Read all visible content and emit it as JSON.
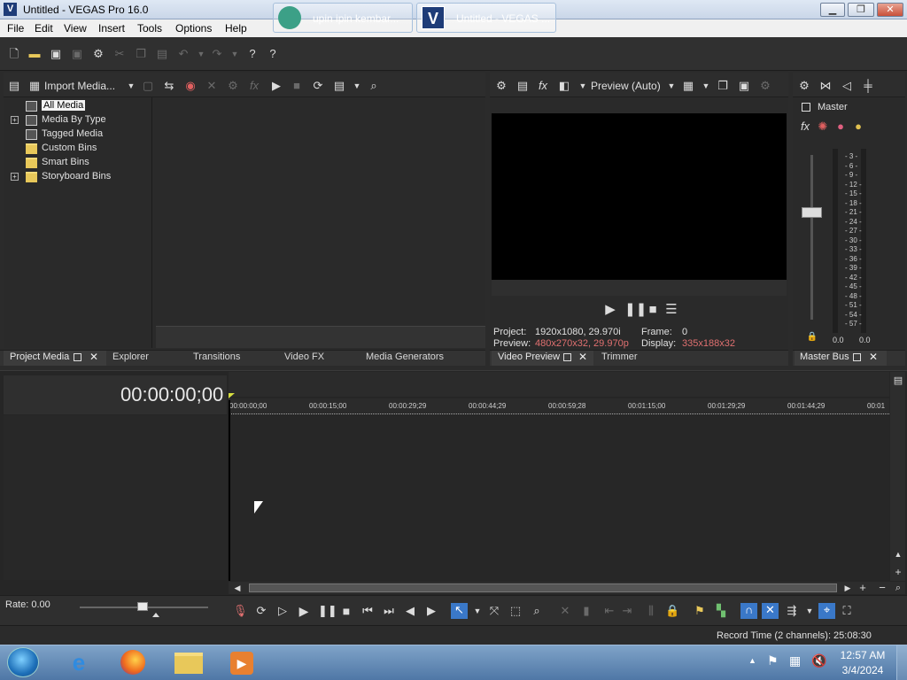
{
  "window": {
    "title": "Untitled - VEGAS Pro 16.0",
    "logo": "V",
    "min": "▁",
    "max": "❐",
    "close": "✕"
  },
  "menu": [
    "File",
    "Edit",
    "View",
    "Insert",
    "Tools",
    "Options",
    "Help"
  ],
  "project_media": {
    "import_label": "Import Media...",
    "tree": [
      {
        "label": "All Media",
        "selected": true,
        "expandable": false,
        "icon": "bin-icon"
      },
      {
        "label": "Media By Type",
        "expandable": true,
        "icon": "bin-icon"
      },
      {
        "label": "Tagged Media",
        "expandable": false,
        "icon": "bin-icon"
      },
      {
        "label": "Custom Bins",
        "expandable": false,
        "icon": "folder-icon"
      },
      {
        "label": "Smart Bins",
        "expandable": false,
        "icon": "folder-icon"
      },
      {
        "label": "Storyboard Bins",
        "expandable": true,
        "icon": "folder-icon"
      }
    ],
    "tabs": [
      "Project Media",
      "Explorer",
      "Transitions",
      "Video FX",
      "Media Generators"
    ]
  },
  "preview": {
    "mode": "Preview (Auto)",
    "project_label": "Project:",
    "project_value": "1920x1080, 29.970i",
    "frame_label": "Frame:",
    "frame_value": "0",
    "preview_label": "Preview:",
    "preview_value": "480x270x32, 29.970p",
    "display_label": "Display:",
    "display_value": "335x188x32",
    "tabs": [
      "Video Preview",
      "Trimmer"
    ],
    "value_color": "#e07070"
  },
  "master": {
    "title": "Master",
    "tab": "Master Bus",
    "scale": [
      "3",
      "6",
      "9",
      "12",
      "15",
      "18",
      "21",
      "24",
      "27",
      "30",
      "33",
      "36",
      "39",
      "42",
      "45",
      "48",
      "51",
      "54",
      "57"
    ],
    "left_value": "0.0",
    "right_value": "0.0"
  },
  "timeline": {
    "timecode": "00:00:00;00",
    "ruler": [
      "00:00:00;00",
      "00:00:15;00",
      "00:00:29;29",
      "00:00:44;29",
      "00:00:59;28",
      "00:01:15;00",
      "00:01:29;29",
      "00:01:44;29",
      "00:01"
    ],
    "rate": "Rate: 0.00",
    "record_time": "Record Time (2 channels): 25:08:30"
  },
  "taskbar": {
    "tasks": [
      "upin ipin kembar...",
      "Untitled - VEGAS ..."
    ],
    "time": "12:57 AM",
    "date": "3/4/2024"
  },
  "colors": {
    "accent": "#3a78c8",
    "bg": "#2b2b2b",
    "panel": "#2a2a2a"
  }
}
